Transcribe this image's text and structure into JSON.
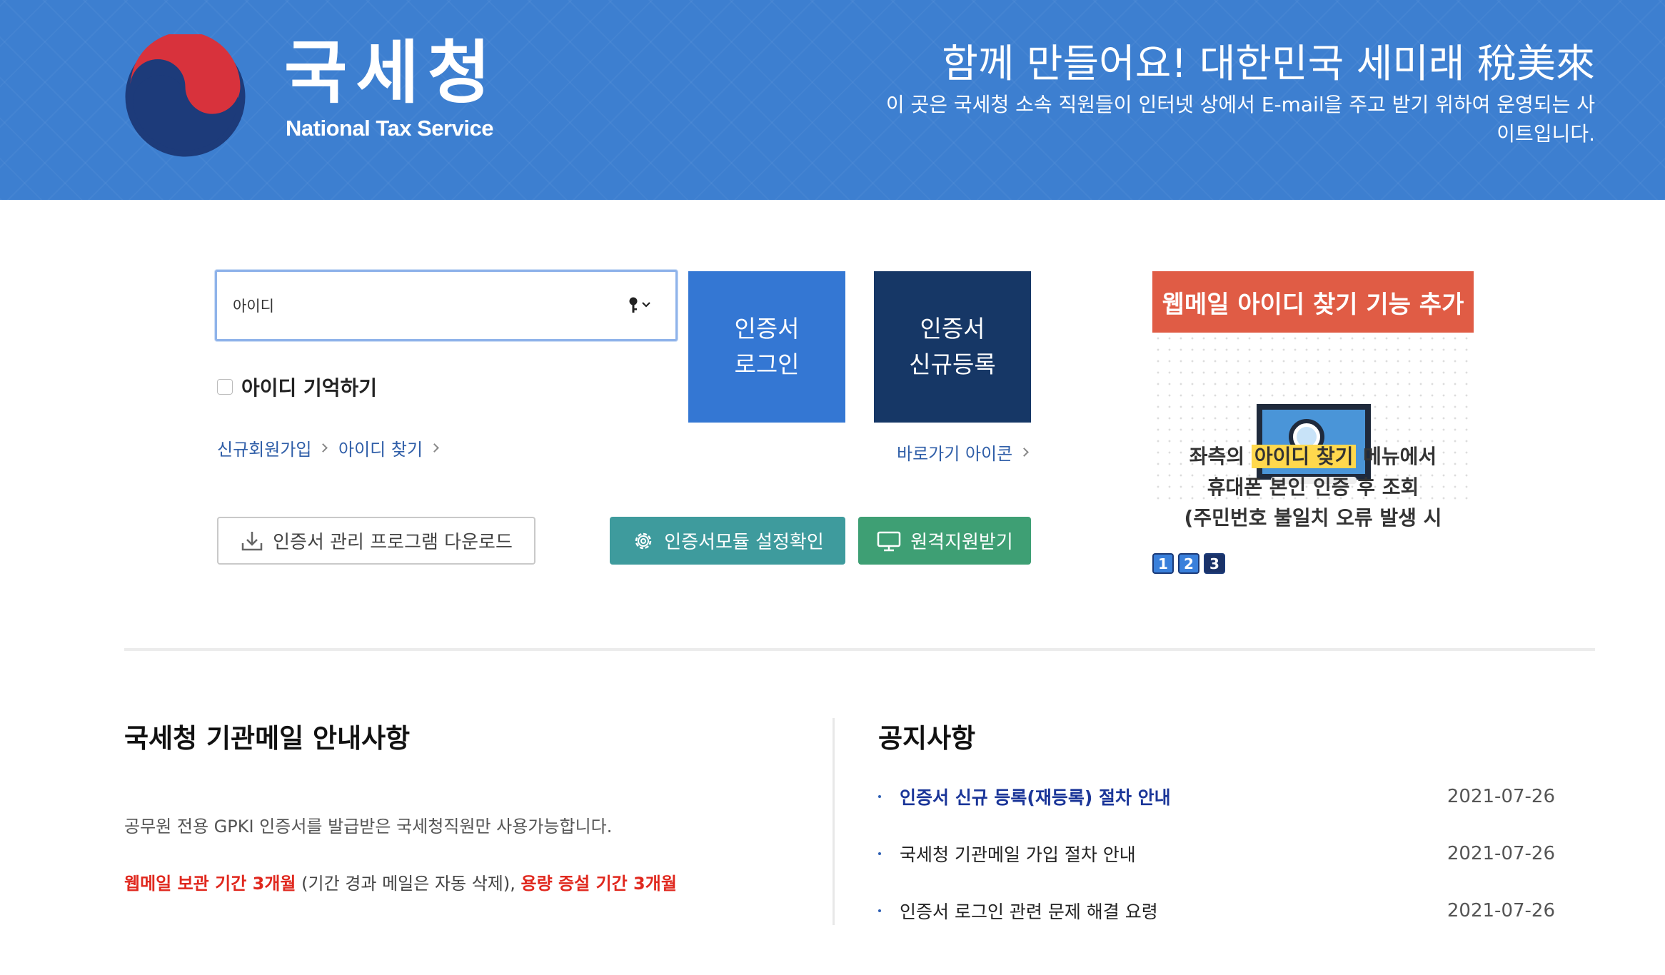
{
  "header": {
    "org_name_ko": "국세청",
    "org_name_en": "National Tax Service",
    "slogan": "함께 만들어요! 대한민국 세미래 稅美來",
    "description": "이 곳은 국세청 소속 직원들이 인터넷 상에서 E-mail을 주고 받기 위하여 운영되는 사이트입니다.",
    "bg_color": "#3d7fd0"
  },
  "login": {
    "id_placeholder": "아이디",
    "key_icon": "key-icon",
    "remember_label": "아이디 기억하기",
    "signup_link": "신규회원가입",
    "find_id_link": "아이디 찾기",
    "cert_login_line1": "인증서",
    "cert_login_line2": "로그인",
    "cert_register_line1": "인증서",
    "cert_register_line2": "신규등록",
    "shortcut_link": "바로가기 아이콘",
    "download_label": "인증서 관리 프로그램 다운로드",
    "module_label": "인증서모듈 설정확인",
    "remote_label": "원격지원받기"
  },
  "banner": {
    "title": "웹메일 아이디 찾기 기능 추가",
    "line1_pre": "좌측의",
    "line1_highlight": "아이디 찾기",
    "line1_post": "메뉴에서",
    "line2": "휴대폰 본인 인증 후 조회",
    "line3": "(주민번호 불일치 오류 발생 시",
    "pages": [
      "1",
      "2",
      "3"
    ],
    "active_page": "3",
    "title_color": "#e05c45"
  },
  "info": {
    "title": "국세청 기관메일 안내사항",
    "text": "공무원 전용 GPKI 인증서를 발급받은 국세청직원만 사용가능합니다.",
    "red1": "웹메일 보관 기간 3개월",
    "middle": " (기간 경과 메일은 자동 삭제), ",
    "red2": "용량 증설 기간 3개월"
  },
  "notices": {
    "title": "공지사항",
    "items": [
      {
        "title": "인증서 신규 등록(재등록) 절차 안내",
        "date": "2021-07-26"
      },
      {
        "title": "국세청 기관메일 가입 절차 안내",
        "date": "2021-07-26"
      },
      {
        "title": "인증서 로그인 관련 문제 해결 요령",
        "date": "2021-07-26"
      }
    ]
  }
}
